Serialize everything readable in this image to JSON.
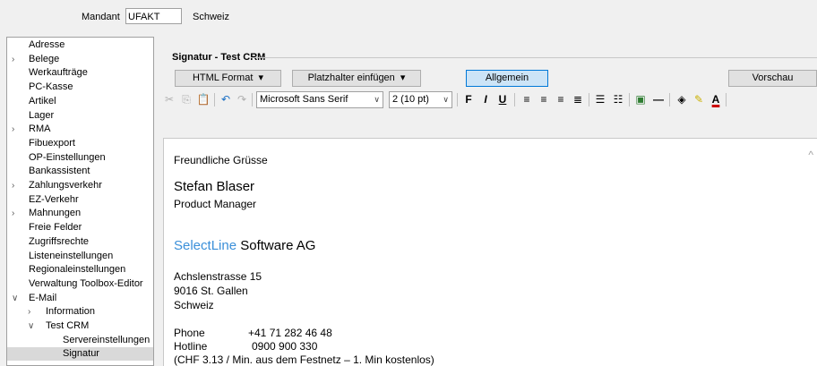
{
  "header": {
    "mandant_label": "Mandant",
    "mandant_value": "UFAKT",
    "mandant_name": "Schweiz"
  },
  "sidebar": {
    "items": [
      {
        "label": "Adresse",
        "arrow": ""
      },
      {
        "label": "Belege",
        "arrow": ">"
      },
      {
        "label": "Werkaufträge",
        "arrow": ""
      },
      {
        "label": "PC-Kasse",
        "arrow": ""
      },
      {
        "label": "Artikel",
        "arrow": ""
      },
      {
        "label": "Lager",
        "arrow": ""
      },
      {
        "label": "RMA",
        "arrow": ">"
      },
      {
        "label": "Fibuexport",
        "arrow": ""
      },
      {
        "label": "OP-Einstellungen",
        "arrow": ""
      },
      {
        "label": "Bankassistent",
        "arrow": ""
      },
      {
        "label": "Zahlungsverkehr",
        "arrow": ">"
      },
      {
        "label": "EZ-Verkehr",
        "arrow": ""
      },
      {
        "label": "Mahnungen",
        "arrow": ">"
      },
      {
        "label": "Freie Felder",
        "arrow": ""
      },
      {
        "label": "Zugriffsrechte",
        "arrow": ""
      },
      {
        "label": "Listeneinstellungen",
        "arrow": ""
      },
      {
        "label": "Regionaleinstellungen",
        "arrow": ""
      },
      {
        "label": "Verwaltung Toolbox-Editor",
        "arrow": ""
      },
      {
        "label": "E-Mail",
        "arrow": "v"
      },
      {
        "label": "Information",
        "arrow": ">"
      },
      {
        "label": "Test CRM",
        "arrow": "v"
      },
      {
        "label": "Servereinstellungen",
        "arrow": ""
      },
      {
        "label": "Signatur",
        "arrow": ""
      }
    ]
  },
  "main": {
    "title": "Signatur - Test CRM",
    "buttons": {
      "html_format": "HTML Format",
      "placeholder": "Platzhalter einfügen",
      "allgemein": "Allgemein",
      "vorschau": "Vorschau"
    },
    "font_name": "Microsoft Sans Serif",
    "font_size": "2 (10 pt)",
    "format_bold": "F",
    "format_italic": "I",
    "format_underline": "U",
    "font_color_letter": "A"
  },
  "signature": {
    "greeting": "Freundliche Grüsse",
    "name": "Stefan Blaser",
    "position": "Product Manager",
    "company_brand": "SelectLine",
    "company_rest": " Software AG",
    "brand_color": "#3a8fd9",
    "street": "Achslenstrasse 15",
    "city": "9016 St. Gallen",
    "country": "Schweiz",
    "phone_label": "Phone",
    "phone_value": "+41 71 282 46 48",
    "hotline_label": "Hotline",
    "hotline_value": "0900 900 330",
    "hotline_note": "(CHF 3.13 / Min. aus dem Festnetz – 1. Min kostenlos)"
  }
}
